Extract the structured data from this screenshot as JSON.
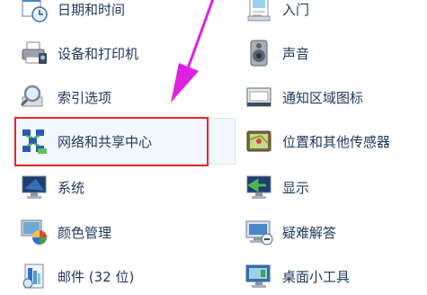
{
  "control_panel": {
    "left_items": [
      {
        "label": "日期和时间",
        "icon": "calendar-clock-icon"
      },
      {
        "label": "设备和打印机",
        "icon": "printer-icon"
      },
      {
        "label": "索引选项",
        "icon": "index-search-icon"
      },
      {
        "label": "网络和共享中心",
        "icon": "network-icon"
      },
      {
        "label": "系统",
        "icon": "computer-icon"
      },
      {
        "label": "颜色管理",
        "icon": "color-management-icon"
      },
      {
        "label": "邮件 (32 位)",
        "icon": "mail-icon"
      }
    ],
    "right_items": [
      {
        "label": "入门",
        "icon": "getting-started-icon"
      },
      {
        "label": "声音",
        "icon": "speaker-icon"
      },
      {
        "label": "通知区域图标",
        "icon": "notification-area-icon"
      },
      {
        "label": "位置和其他传感器",
        "icon": "location-sensor-icon"
      },
      {
        "label": "显示",
        "icon": "display-icon"
      },
      {
        "label": "疑难解答",
        "icon": "troubleshooting-icon"
      },
      {
        "label": "桌面小工具",
        "icon": "gadgets-icon"
      }
    ]
  },
  "annotation": {
    "highlight_color": "#e8242a",
    "arrow_color": "#e020e0"
  }
}
